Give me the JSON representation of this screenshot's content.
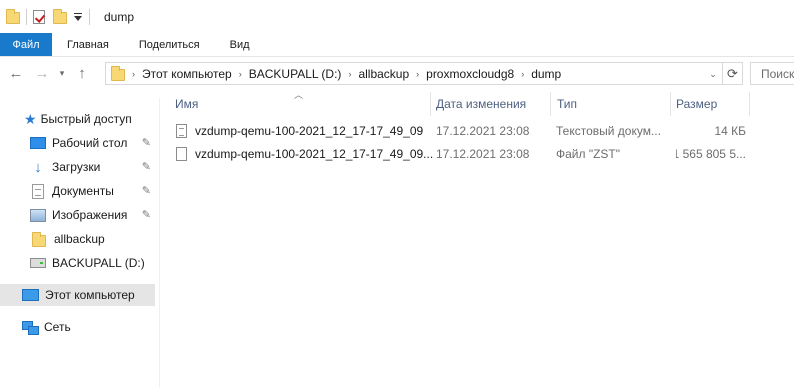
{
  "window": {
    "title": "dump"
  },
  "ribbon": {
    "tabs": [
      "Файл",
      "Главная",
      "Поделиться",
      "Вид"
    ]
  },
  "address": {
    "crumbs": [
      "Этот компьютер",
      "BACKUPALL (D:)",
      "allbackup",
      "proxmoxcloudg8",
      "dump"
    ]
  },
  "search": {
    "placeholder": "Поиск"
  },
  "sidebar": {
    "quick_access": "Быстрый доступ",
    "items": [
      {
        "label": "Рабочий стол",
        "icon": "desktop-icon",
        "pinned": true
      },
      {
        "label": "Загрузки",
        "icon": "downloads-icon",
        "pinned": true
      },
      {
        "label": "Документы",
        "icon": "documents-icon",
        "pinned": true
      },
      {
        "label": "Изображения",
        "icon": "pictures-icon",
        "pinned": true
      },
      {
        "label": "allbackup",
        "icon": "folder-icon",
        "pinned": false
      },
      {
        "label": "BACKUPALL (D:)",
        "icon": "drive-icon",
        "pinned": false
      }
    ],
    "this_pc": "Этот компьютер",
    "network": "Сеть"
  },
  "columns": {
    "name": "Имя",
    "date": "Дата изменения",
    "type": "Тип",
    "size": "Размер"
  },
  "files": [
    {
      "name": "vzdump-qemu-100-2021_12_17-17_49_09",
      "date": "17.12.2021 23:08",
      "type": "Текстовый докум...",
      "size": "14 КБ",
      "icon": "text-file-icon"
    },
    {
      "name": "vzdump-qemu-100-2021_12_17-17_49_09...",
      "date": "17.12.2021 23:08",
      "type": "Файл \"ZST\"",
      "size": "1 565 805 5...",
      "icon": "file-icon"
    }
  ],
  "colors": {
    "accent": "#1979ca",
    "header_text": "#4d6082",
    "selected_bg": "#e5e5e5"
  }
}
